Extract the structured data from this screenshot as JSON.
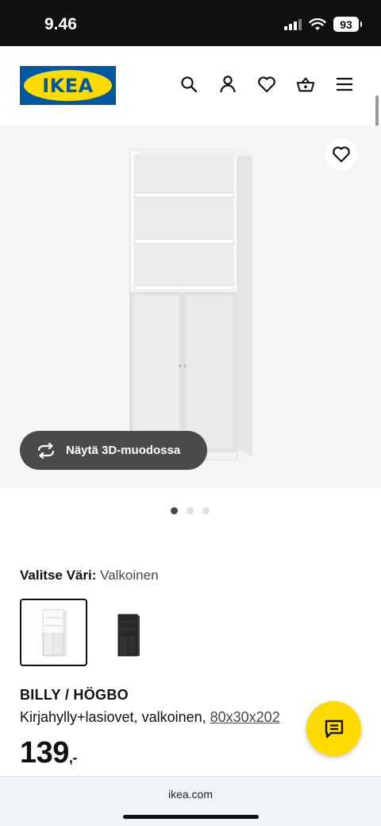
{
  "status_bar": {
    "time": "9.46",
    "battery": "93"
  },
  "header": {
    "logo_text": "IKEA",
    "icons": [
      "search-icon",
      "account-icon",
      "favourites-icon",
      "basket-icon",
      "menu-icon"
    ]
  },
  "gallery": {
    "button_3d_label": "Näytä 3D-muodossa",
    "dot_count": 3,
    "active_dot": 1
  },
  "color_selector": {
    "label": "Valitse Väri:",
    "value": "Valkoinen",
    "options": [
      "white",
      "black-brown"
    ],
    "selected": 0
  },
  "product": {
    "name": "BILLY / HÖGBO",
    "description": "Kirjahylly+lasiovet, valkoinen, ",
    "size": "80x30x202",
    "price_integer": "139",
    "price_decimal": ",-"
  },
  "browser": {
    "url": "ikea.com"
  },
  "colors": {
    "ikea_blue": "#0058a3",
    "ikea_yellow": "#ffdb00"
  }
}
